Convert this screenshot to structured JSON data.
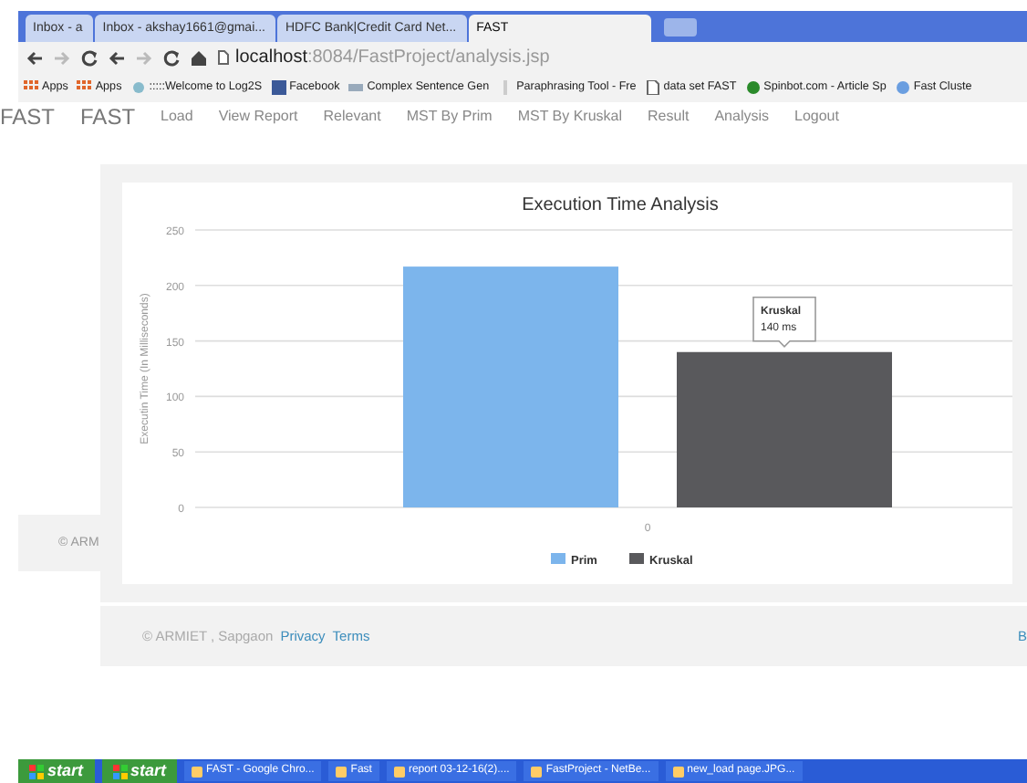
{
  "browser": {
    "tabs": [
      {
        "label": "Inbox - a",
        "selected": false
      },
      {
        "label": "Inbox - akshay1661@gmai...",
        "selected": false
      },
      {
        "label": "HDFC Bank|Credit Card Net...",
        "selected": false
      },
      {
        "label": "FAST",
        "selected": true
      }
    ],
    "address": {
      "host": "localhost",
      "path": ":8084/FastProject/analysis.jsp"
    },
    "bookmarks": [
      "Apps",
      "Apps",
      ":::::Welcome to Log2S",
      "Facebook",
      "Complex Sentence Gen",
      "Paraphrasing Tool - Fre",
      "data set FAST",
      "Spinbot.com - Article Sp",
      "Fast Cluste"
    ]
  },
  "navbar": {
    "brand": "FAST",
    "items": [
      {
        "label": "FAST",
        "kind": "brand"
      },
      {
        "label": "Load",
        "kind": "link"
      },
      {
        "label": "View Report",
        "kind": "link"
      },
      {
        "label": "Relevant",
        "kind": "link"
      },
      {
        "label": "MST By Prim",
        "kind": "link"
      },
      {
        "label": "MST By Kruskal",
        "kind": "link"
      },
      {
        "label": "Result",
        "kind": "link"
      },
      {
        "label": "Analysis",
        "kind": "link"
      },
      {
        "label": "Logout",
        "kind": "link"
      }
    ]
  },
  "background_footer": {
    "text": "© ARM"
  },
  "chart_panel": {
    "chart_data": {
      "type": "bar",
      "title": "Execution Time Analysis",
      "ylabel": "Executin Time (In Milliseconds)",
      "categories": [
        "0"
      ],
      "series": [
        {
          "name": "Prim",
          "color": "#7cb5ec",
          "values": [
            217
          ]
        },
        {
          "name": "Kruskal",
          "color": "#59595c",
          "values": [
            140
          ]
        }
      ],
      "grid": true,
      "legend": true,
      "ylim": [
        0,
        250
      ],
      "yticks": [
        0,
        50,
        100,
        150,
        200,
        250
      ]
    },
    "tooltip": {
      "title": "Kruskal",
      "text": "140 ms"
    }
  },
  "footer": {
    "copyright": "© ARMIET , Sapgaon",
    "links": [
      "Privacy",
      "Terms"
    ],
    "right_text": "B"
  },
  "taskbar": {
    "start_buttons": [
      "start",
      "start"
    ],
    "tasks": [
      "FAST - Google Chro...",
      "Fast",
      "report 03-12-16(2)....",
      "FastProject - NetBe...",
      "new_load page.JPG..."
    ]
  }
}
